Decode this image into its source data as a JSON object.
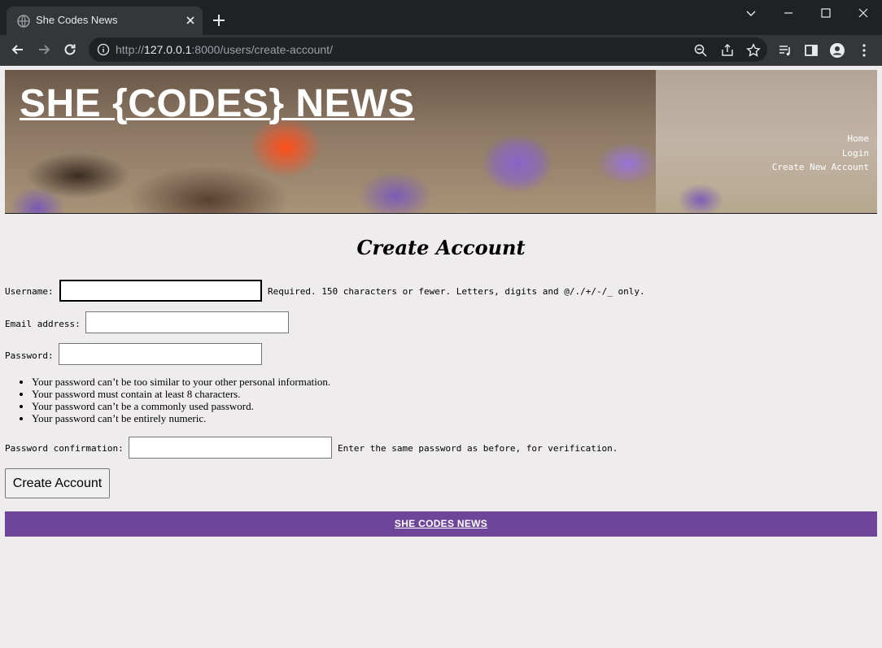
{
  "browser": {
    "tab_title": "She Codes News",
    "url_prefix": "http://",
    "url_host": "127.0.0.1",
    "url_rest": ":8000/users/create-account/"
  },
  "header": {
    "site_title": "SHE {CODES} NEWS",
    "nav": [
      "Home",
      "Login",
      "Create New Account"
    ]
  },
  "page": {
    "title": "Create Account"
  },
  "form": {
    "username": {
      "label": "Username:",
      "value": "",
      "help": "Required. 150 characters or fewer. Letters, digits and @/./+/-/_ only."
    },
    "email": {
      "label": "Email address:",
      "value": ""
    },
    "password": {
      "label": "Password:",
      "value": ""
    },
    "password_help": [
      "Your password can’t be too similar to your other personal information.",
      "Your password must contain at least 8 characters.",
      "Your password can’t be a commonly used password.",
      "Your password can’t be entirely numeric."
    ],
    "password_confirm": {
      "label": "Password confirmation:",
      "value": "",
      "help": "Enter the same password as before, for verification."
    },
    "submit_label": "Create Account"
  },
  "footer": {
    "text": "SHE CODES NEWS"
  }
}
